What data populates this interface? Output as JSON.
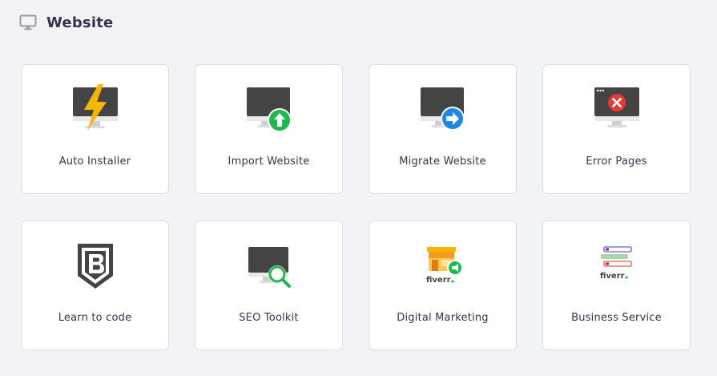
{
  "header": {
    "title": "Website",
    "icon": "monitor-icon"
  },
  "cards": [
    {
      "label": "Auto Installer",
      "icon": "lightning-monitor-icon"
    },
    {
      "label": "Import Website",
      "icon": "import-monitor-icon"
    },
    {
      "label": "Migrate Website",
      "icon": "migrate-monitor-icon"
    },
    {
      "label": "Error Pages",
      "icon": "error-monitor-icon"
    },
    {
      "label": "Learn to code",
      "icon": "code-badge-icon"
    },
    {
      "label": "SEO Toolkit",
      "icon": "seo-monitor-icon"
    },
    {
      "label": "Digital Marketing",
      "icon": "fiverr-marketing-icon",
      "brand_text": "fiverr."
    },
    {
      "label": "Business Service",
      "icon": "fiverr-business-icon",
      "brand_text": "fiverr."
    }
  ],
  "colors": {
    "background": "#f2f3f6",
    "card": "#ffffff",
    "border": "#dadce0",
    "text": "#36344d",
    "monitor": "#444444",
    "lightning": "#f7b500",
    "green": "#1fb84f",
    "blue": "#1e88e5",
    "red": "#e53935",
    "fiverr_green": "#1dbf73"
  }
}
